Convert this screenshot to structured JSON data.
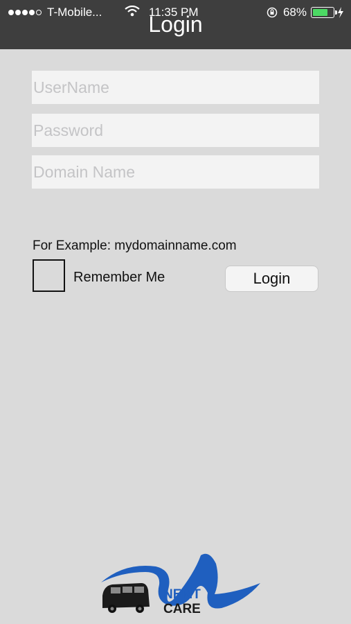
{
  "status_bar": {
    "carrier": "T-Mobile...",
    "time": "11:35 PM",
    "battery_percent": "68%",
    "battery_level": 0.68,
    "signal_bars_filled": 4,
    "signal_bars_total": 5
  },
  "nav": {
    "title": "Login"
  },
  "form": {
    "username_placeholder": "UserName",
    "password_placeholder": "Password",
    "domain_placeholder": "Domain Name",
    "example_text": "For Example: mydomainname.com",
    "remember_label": "Remember Me",
    "remember_checked": false,
    "login_label": "Login"
  },
  "logo": {
    "line1": "NEMT",
    "line2": "CARE"
  },
  "colors": {
    "background": "#dadada",
    "topbar": "#3e3e3e",
    "field_bg": "#f3f3f3",
    "placeholder": "#c4c4c6",
    "logo_blue": "#1f5fbf",
    "battery_green": "#4cd964"
  }
}
